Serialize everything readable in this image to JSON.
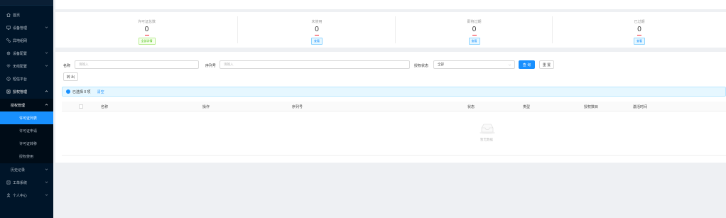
{
  "sidebar": {
    "items": [
      {
        "label": "首页",
        "icon": "home-icon"
      },
      {
        "label": "设备管理",
        "icon": "monitor-icon",
        "chevron": "down"
      },
      {
        "label": "异地组网",
        "icon": "network-icon"
      },
      {
        "label": "设备配置",
        "icon": "gear-icon",
        "chevron": "down"
      },
      {
        "label": "无线配置",
        "icon": "wifi-icon",
        "chevron": "down"
      },
      {
        "label": "短信平台",
        "icon": "message-icon"
      },
      {
        "label": "授权管理",
        "icon": "license-icon",
        "chevron": "up"
      }
    ],
    "sub": {
      "label": "授权管理",
      "chevron": "up"
    },
    "sub_items": [
      {
        "label": "许可证列表",
        "active": true
      },
      {
        "label": "许可证申请"
      },
      {
        "label": "许可证转移"
      },
      {
        "label": "授权使用"
      }
    ],
    "history": {
      "label": "历史记录",
      "chevron": "down"
    },
    "bottom_items": [
      {
        "label": "工单系统",
        "icon": "ticket-icon",
        "chevron": "down"
      },
      {
        "label": "个人中心",
        "icon": "user-icon",
        "chevron": "down"
      }
    ]
  },
  "stats": [
    {
      "label": "许可证总数",
      "value": "0",
      "tag": "全部详情",
      "tag_color": "green"
    },
    {
      "label": "未使用",
      "value": "0",
      "tag": "查看",
      "tag_color": "blue"
    },
    {
      "label": "即将过期",
      "value": "0",
      "tag": "查看",
      "tag_color": "blue"
    },
    {
      "label": "已过期",
      "value": "0",
      "tag": "查看",
      "tag_color": "blue"
    }
  ],
  "filters": {
    "name_label": "名称",
    "name_placeholder": "请输入",
    "serial_label": "序列号",
    "serial_placeholder": "请输入",
    "status_label": "授权状态",
    "status_value": "全部",
    "search_btn": "查 询",
    "reset_btn": "重 置",
    "toolbar_btn": "转 出"
  },
  "alert": {
    "selected_text": "已选择 0 项",
    "clear_text": "清空"
  },
  "table": {
    "columns": [
      "名称",
      "操作",
      "序列号",
      "状态",
      "类型",
      "授权数目",
      "激活时间"
    ]
  },
  "empty_text": "暂无数据",
  "colors": {
    "primary": "#1890ff",
    "sidebar_bg": "#001529",
    "active_bg": "#1890ff"
  }
}
